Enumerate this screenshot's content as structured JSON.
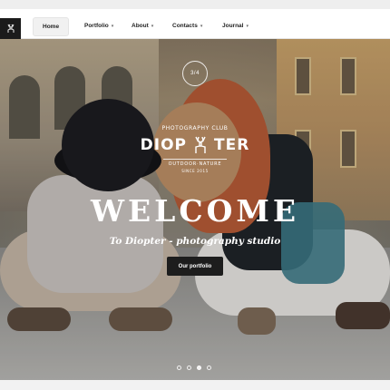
{
  "nav": {
    "items": [
      {
        "label": "Home",
        "active": true,
        "dropdown": false
      },
      {
        "label": "Portfolio",
        "active": false,
        "dropdown": true
      },
      {
        "label": "About",
        "active": false,
        "dropdown": true
      },
      {
        "label": "Contacts",
        "active": false,
        "dropdown": true
      },
      {
        "label": "Journal",
        "active": false,
        "dropdown": true
      }
    ],
    "caret": "▾"
  },
  "hero": {
    "slide_counter": "3/4",
    "brand_top": "PHOTOGRAPHY CLUB",
    "brand_left": "DIOP",
    "brand_right": "TER",
    "brand_sub": "OUTDOOR·NATURE",
    "brand_since": "SINCE 2015",
    "headline": "WELCOME",
    "tagline": "To Diopter - photography studio",
    "cta_label": "Our portfolio",
    "slides": 4,
    "active_slide": 2
  },
  "colors": {
    "cta_bg": "#1d1d1d",
    "nav_active_bg": "#f1f1f1"
  },
  "icons": {
    "logo": "deer-icon"
  }
}
